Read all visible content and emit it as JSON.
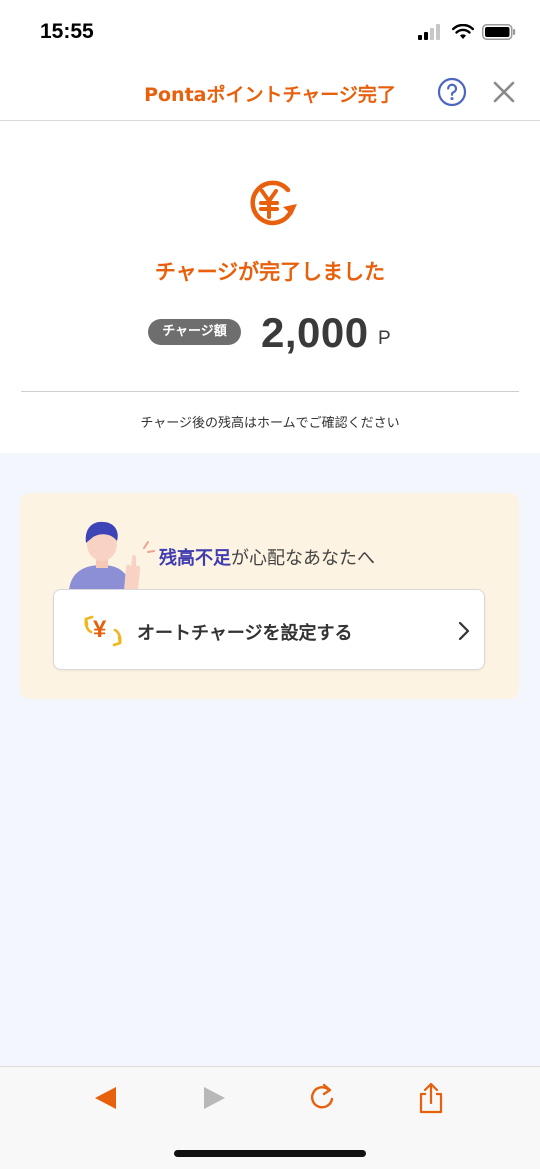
{
  "status_bar": {
    "time": "15:55"
  },
  "header": {
    "title": "Pontaポイントチャージ完了",
    "help_label": "?",
    "close_label": "×"
  },
  "result": {
    "message": "チャージが完了しました",
    "amount_label": "チャージ額",
    "amount_value": "2,000",
    "amount_unit": "P",
    "note": "チャージ後の残高はホームでご確認ください"
  },
  "promo": {
    "highlight": "残高不足",
    "text": "が心配なあなたへ",
    "button_label": "オートチャージを設定する",
    "yen_symbol": "¥"
  },
  "colors": {
    "accent": "#e8600c",
    "highlight": "#3f3cb0",
    "promo_bg": "#fdf3e2",
    "page_bg": "#f3f6fd"
  },
  "icons": [
    "signal-icon",
    "wifi-icon",
    "battery-icon",
    "help-icon",
    "close-icon",
    "yen-refresh-icon",
    "person-illustration",
    "yen-exchange-icon",
    "chevron-right-icon",
    "back-icon",
    "forward-icon",
    "reload-icon",
    "share-icon"
  ]
}
